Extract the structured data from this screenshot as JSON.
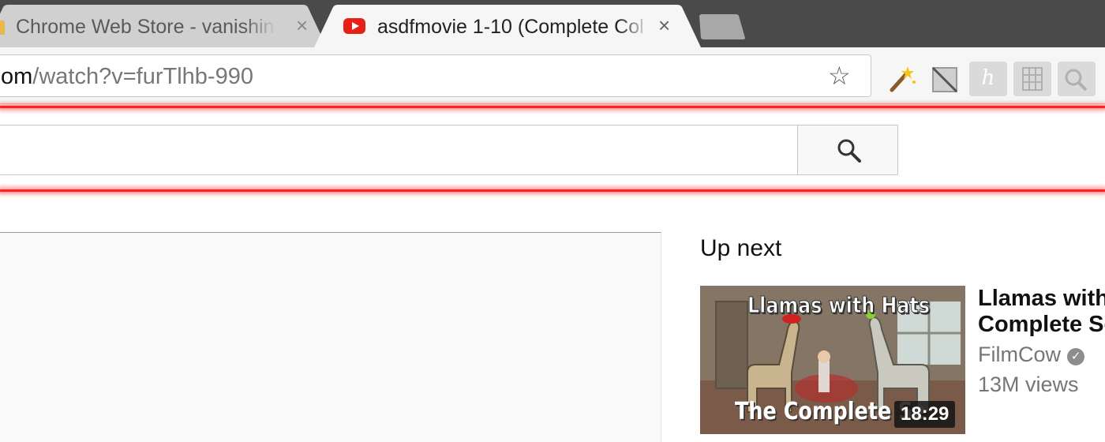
{
  "tabs": [
    {
      "title": "Chrome Web Store - vanishing",
      "close_glyph": "×",
      "active": false
    },
    {
      "title": "asdfmovie 1-10 (Complete Col",
      "close_glyph": "×",
      "active": true,
      "favicon": "youtube-icon"
    }
  ],
  "omnibox": {
    "url_host_part": "om",
    "url_path": "/watch?v=furTlhb-990",
    "bookmark_glyph": "☆"
  },
  "extensions": [
    "magic-wand-icon",
    "slash-icon",
    "honey-h-icon",
    "grid-icon",
    "magnifier-icon"
  ],
  "extension_labels": {
    "honey": "h"
  },
  "search": {
    "placeholder": "",
    "icon": "search-icon"
  },
  "sidebar": {
    "heading": "Up next",
    "video": {
      "thumbnail_title": "Llamas with Hats",
      "thumbnail_subtitle": "The Complete Se",
      "duration": "18:29",
      "title_line1": "Llamas with H",
      "title_line2": "Complete Se",
      "channel": "FilmCow",
      "verified_glyph": "✓",
      "views": "13M views"
    }
  },
  "colors": {
    "glow": "#ff2020",
    "youtube_red": "#e62117",
    "tabstrip": "#4a4a4a"
  }
}
